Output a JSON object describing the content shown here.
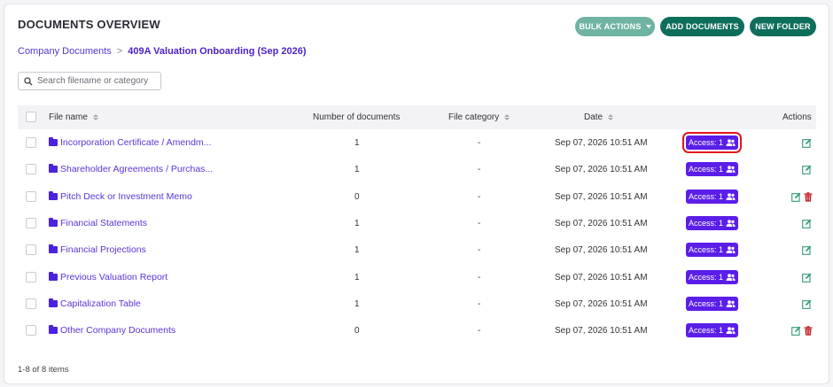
{
  "header": {
    "title": "DOCUMENTS OVERVIEW",
    "bulk_actions_label": "BULK ACTIONS",
    "add_documents_label": "ADD DOCUMENTS",
    "new_folder_label": "NEW FOLDER"
  },
  "breadcrumb": {
    "root": "Company Documents",
    "separator": ">",
    "current": "409A Valuation Onboarding (Sep 2026)"
  },
  "search": {
    "placeholder": "Search filename or category"
  },
  "table": {
    "columns": {
      "file_name": "File name",
      "number_of_documents": "Number of documents",
      "file_category": "File category",
      "date": "Date",
      "actions": "Actions"
    },
    "rows": [
      {
        "name": "Incorporation Certificate / Amendm...",
        "count": "1",
        "category": "-",
        "date": "Sep 07, 2026 10:51 AM",
        "access": "Access: 1",
        "deletable": false
      },
      {
        "name": "Shareholder Agreements / Purchas...",
        "count": "1",
        "category": "-",
        "date": "Sep 07, 2026 10:51 AM",
        "access": "Access: 1",
        "deletable": false
      },
      {
        "name": "Pitch Deck or Investment Memo",
        "count": "0",
        "category": "-",
        "date": "Sep 07, 2026 10:51 AM",
        "access": "Access: 1",
        "deletable": true
      },
      {
        "name": "Financial Statements",
        "count": "1",
        "category": "-",
        "date": "Sep 07, 2026 10:51 AM",
        "access": "Access: 1",
        "deletable": false
      },
      {
        "name": "Financial Projections",
        "count": "1",
        "category": "-",
        "date": "Sep 07, 2026 10:51 AM",
        "access": "Access: 1",
        "deletable": false
      },
      {
        "name": "Previous Valuation Report",
        "count": "1",
        "category": "-",
        "date": "Sep 07, 2026 10:51 AM",
        "access": "Access: 1",
        "deletable": false
      },
      {
        "name": "Capitalization Table",
        "count": "1",
        "category": "-",
        "date": "Sep 07, 2026 10:51 AM",
        "access": "Access: 1",
        "deletable": false
      },
      {
        "name": "Other Company Documents",
        "count": "0",
        "category": "-",
        "date": "Sep 07, 2026 10:51 AM",
        "access": "Access: 1",
        "deletable": true
      }
    ]
  },
  "footer": {
    "pagination": "1-8 of 8 items"
  },
  "colors": {
    "primary_green": "#0e6e5c",
    "light_green": "#6fb3a2",
    "accent_purple": "#5b1ee8",
    "link_purple": "#5b34d6",
    "edit_green": "#2e9b72",
    "delete_red": "#c0171e",
    "highlight_red": "#e0161d"
  },
  "icons": {
    "search": "search-icon",
    "folder": "folder-icon",
    "people": "people-icon",
    "edit": "edit-icon",
    "delete": "trash-icon"
  }
}
